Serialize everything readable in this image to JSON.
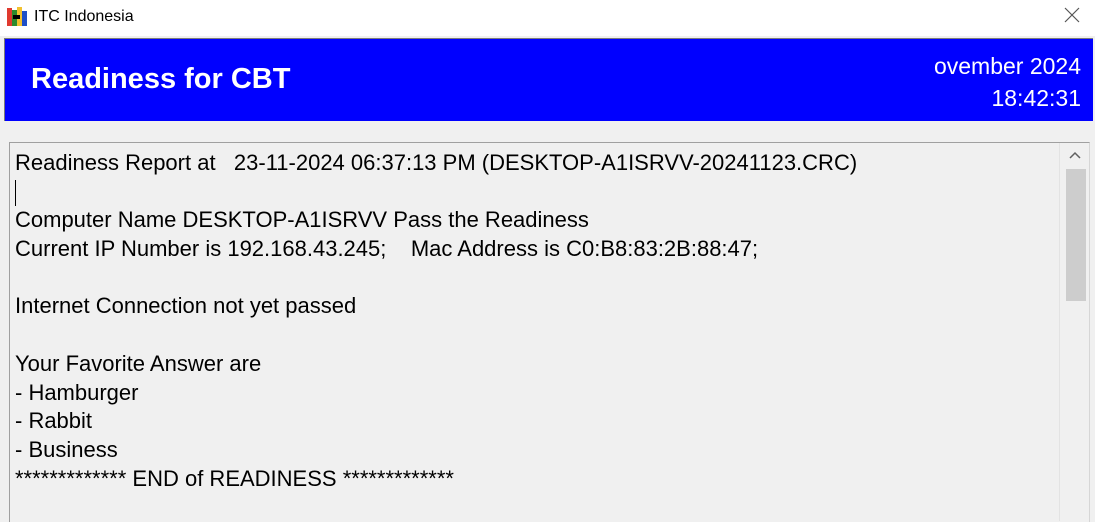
{
  "window": {
    "title": "ITC Indonesia",
    "icon": "app-logo-icon",
    "close_icon": "close-icon"
  },
  "header": {
    "title": "Readiness for CBT",
    "date": "ovember 2024",
    "time": "18:42:31",
    "background": "#0000ff"
  },
  "report": {
    "lines": [
      "Readiness Report at   23-11-2024 06:37:13 PM (DESKTOP-A1ISRVV-20241123.CRC)",
      "",
      "Computer Name DESKTOP-A1ISRVV Pass the Readiness",
      "Current IP Number is 192.168.43.245;    Mac Address is C0:B8:83:2B:88:47;",
      "",
      "Internet Connection not yet passed",
      "",
      "Your Favorite Answer are",
      "- Hamburger",
      "- Rabbit",
      "- Business",
      "************* END of READINESS *************"
    ]
  },
  "scrollbar": {
    "up_icon": "chevron-up-icon"
  }
}
